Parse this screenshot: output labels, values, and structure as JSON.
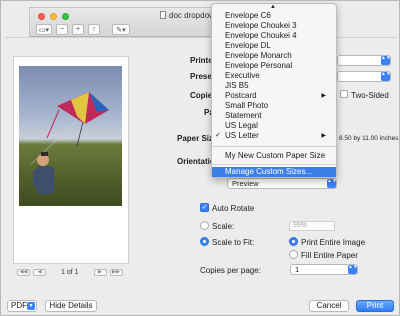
{
  "window": {
    "title": "doc dropdown mo",
    "toolbar_icons": [
      "sidebar-icon",
      "zoom-out-icon",
      "zoom-in-icon",
      "share-icon",
      "pen-icon"
    ]
  },
  "form": {
    "printer_label": "Printer",
    "presets_label": "Presets",
    "copies_label": "Copies",
    "two_sided_label": "Two-Sided",
    "pages_label": "Pages",
    "paper_size_label": "Paper Size",
    "paper_size_value": "8.50 by 11.00 inches",
    "orientation_label": "Orientation",
    "preview_value": "Preview",
    "auto_rotate_label": "Auto Rotate",
    "scale_label": "Scale:",
    "scale_value": "99%",
    "scale_to_fit_label": "Scale to Fit:",
    "print_entire_image_label": "Print Entire Image",
    "fill_entire_paper_label": "Fill Entire Paper",
    "copies_per_page_label": "Copies per page:",
    "copies_per_page_value": "1"
  },
  "preview": {
    "page_indicator": "1 of 1"
  },
  "menu": {
    "items": [
      {
        "label": "Envelope C6",
        "checked": false,
        "submenu": false
      },
      {
        "label": "Envelope Choukei 3",
        "checked": false,
        "submenu": false
      },
      {
        "label": "Envelope Choukei 4",
        "checked": false,
        "submenu": false
      },
      {
        "label": "Envelope DL",
        "checked": false,
        "submenu": false
      },
      {
        "label": "Envelope Monarch",
        "checked": false,
        "submenu": false
      },
      {
        "label": "Envelope Personal",
        "checked": false,
        "submenu": false
      },
      {
        "label": "Executive",
        "checked": false,
        "submenu": false
      },
      {
        "label": "JIS B5",
        "checked": false,
        "submenu": false
      },
      {
        "label": "Postcard",
        "checked": false,
        "submenu": true
      },
      {
        "label": "Small Photo",
        "checked": false,
        "submenu": false
      },
      {
        "label": "Statement",
        "checked": false,
        "submenu": false
      },
      {
        "label": "US Legal",
        "checked": false,
        "submenu": false
      },
      {
        "label": "US Letter",
        "checked": true,
        "submenu": true
      }
    ],
    "custom_item": "My New Custom Paper Size",
    "manage_item": "Manage Custom Sizes..."
  },
  "footer": {
    "pdf_label": "PDF",
    "hide_details_label": "Hide Details",
    "cancel_label": "Cancel",
    "print_label": "Print"
  },
  "colors": {
    "accent": "#3b82f6",
    "menu_highlight": "#3b7fe8"
  }
}
